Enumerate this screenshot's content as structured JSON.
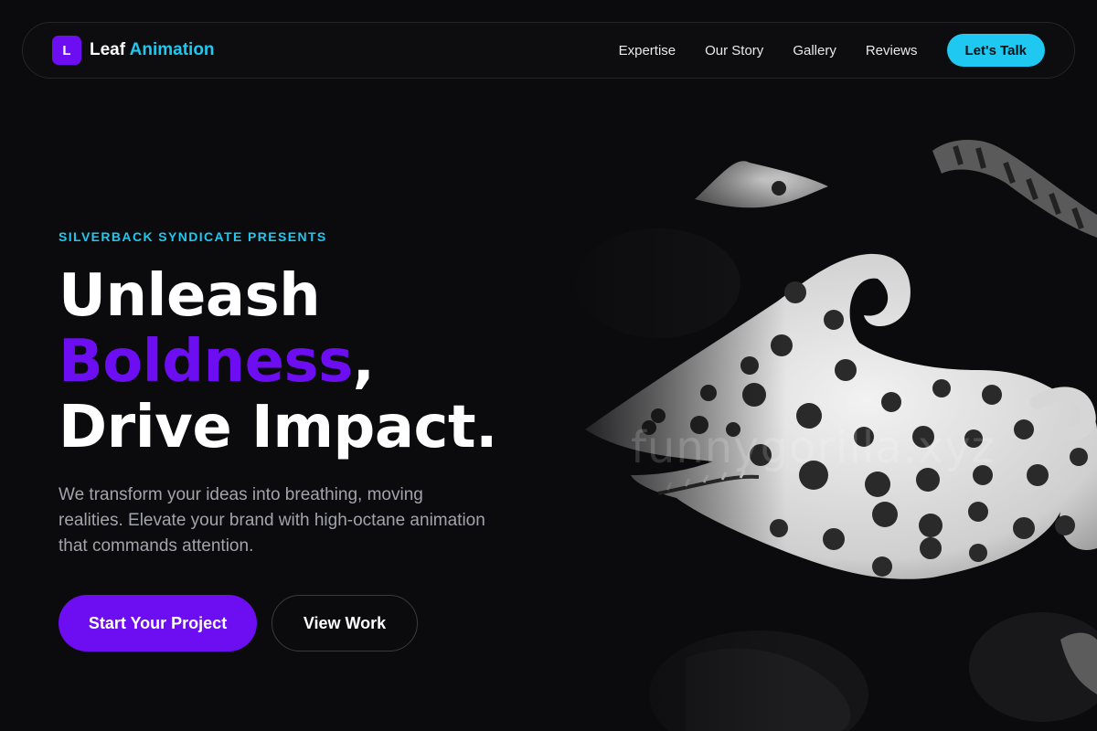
{
  "nav": {
    "logo_letter": "L",
    "logo_word": "Leaf",
    "logo_accent": "Animation",
    "links": [
      "Expertise",
      "Our Story",
      "Gallery",
      "Reviews"
    ],
    "cta": "Let's Talk"
  },
  "hero": {
    "eyebrow": "SILVERBACK SYNDICATE PRESENTS",
    "headline_line1": "Unleash",
    "headline_highlight": "Boldness",
    "headline_comma": ",",
    "headline_line3": "Drive Impact.",
    "lead": "We transform your ideas into breathing, moving realities. Elevate your brand with high-octane animation that commands attention.",
    "primary_button": "Start Your Project",
    "secondary_button": "View Work",
    "image_watermark": "funnygorilla.xyz"
  },
  "colors": {
    "background": "#0b0b0d",
    "brand_purple": "#6d0df2",
    "brand_cyan": "#1ec8f0",
    "muted_text": "#a3a3ad"
  },
  "icons": {
    "logo": "letter-L-mark"
  }
}
